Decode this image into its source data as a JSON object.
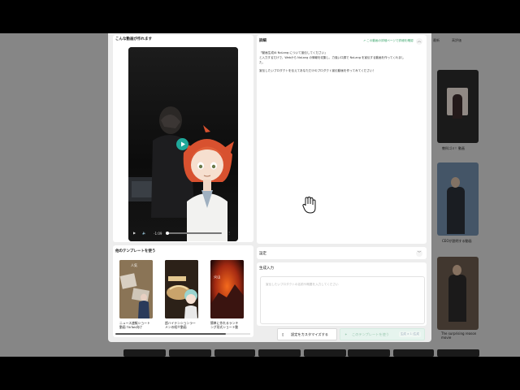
{
  "background_page": {
    "tabs": [
      "最新",
      "高評価"
    ],
    "right_cards": [
      {
        "caption": "教科ゴミ！動画"
      },
      {
        "caption": "CEOが説明する動画"
      },
      {
        "caption": "The surprising reason movie"
      }
    ]
  },
  "modal": {
    "preview_label": "こんな動画が作れます",
    "video": {
      "time": "-1:09",
      "play_icon": "play-icon",
      "volume_icon": "volume-icon"
    },
    "other_templates_label": "他のテンプレートを使う",
    "templates": [
      {
        "title_line1": "ニュース速報ショート",
        "title_line2": "動画 TikTok向け",
        "overlay": "人気"
      },
      {
        "title_line1": "超ハイテンションラー",
        "title_line2": "メンの紹介動画",
        "overlay": ""
      },
      {
        "title_line1": "簡単に作れるランキ",
        "title_line2": "ング形式ショート動",
        "overlay": ""
      }
    ],
    "details": {
      "label": "詳細",
      "link": "この動画の詳細ページで詳細を確認",
      "body_line1": "「動画生成AI NoLang について宣伝してください」",
      "body_line2": "と入力するだけで、Webから NoLang の情報を収集し、力強い口調で NoLang を宣伝する動画を作ってくれまし",
      "body_line3": "た。",
      "body_line4": "宣伝したいプロダクトを伝えてあなただけのプロダクト宣伝動画を作ってみてください！"
    },
    "settings_label": "設定",
    "generate_label": "生成入力",
    "input_placeholder": "宣伝したいプロダクトの名前や概要を入力してください",
    "customize_button": "設定をカスタマイズする",
    "use_template_button": "このテンプレートを使う",
    "use_template_badge": "生成 × 1 /生成"
  },
  "colors": {
    "accent": "#1fa89a",
    "link_green": "#3aa56b",
    "disabled_button": "#e6f4ee"
  }
}
